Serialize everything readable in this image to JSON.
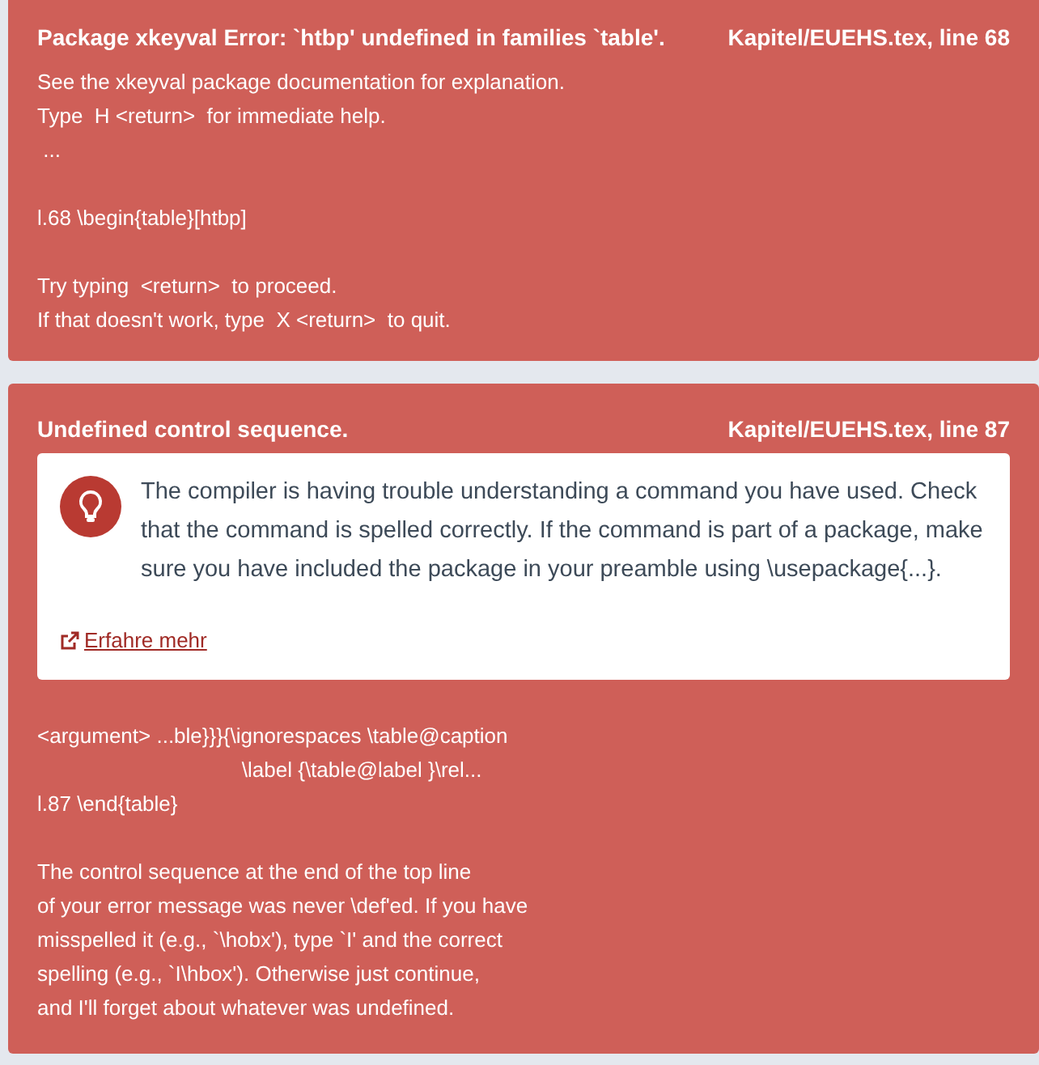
{
  "errors": [
    {
      "title": "Package xkeyval Error: `htbp' undefined in families `table'.",
      "location": "Kapitel/EUEHS.tex, line 68",
      "log": [
        [
          "See the xkeyval package documentation for explanation.",
          "Type  H <return>  for immediate help.",
          " ..."
        ],
        [
          "l.68 \\begin{table}[htbp]"
        ],
        [
          "Try typing  <return>  to proceed.",
          "If that doesn't work, type  X <return>  to quit."
        ]
      ]
    },
    {
      "title": "Undefined control sequence.",
      "location": "Kapitel/EUEHS.tex, line 87",
      "hint": {
        "text": "The compiler is having trouble understanding a command you have used. Check that the command is spelled correctly. If the command is part of a package, make sure you have included the package in your preamble using \\usepackage{...}.",
        "link": "Erfahre mehr"
      },
      "log": [
        [
          "<argument> ...ble}}}{\\ignorespaces \\table@caption",
          "                                   \\label {\\table@label }\\rel...",
          "l.87 \\end{table}"
        ],
        [
          "The control sequence at the end of the top line",
          "of your error message was never \\def'ed. If you have",
          "misspelled it (e.g., `\\hobx'), type `I' and the correct",
          "spelling (e.g., `I\\hbox'). Otherwise just continue,",
          "and I'll forget about whatever was undefined."
        ]
      ]
    }
  ]
}
